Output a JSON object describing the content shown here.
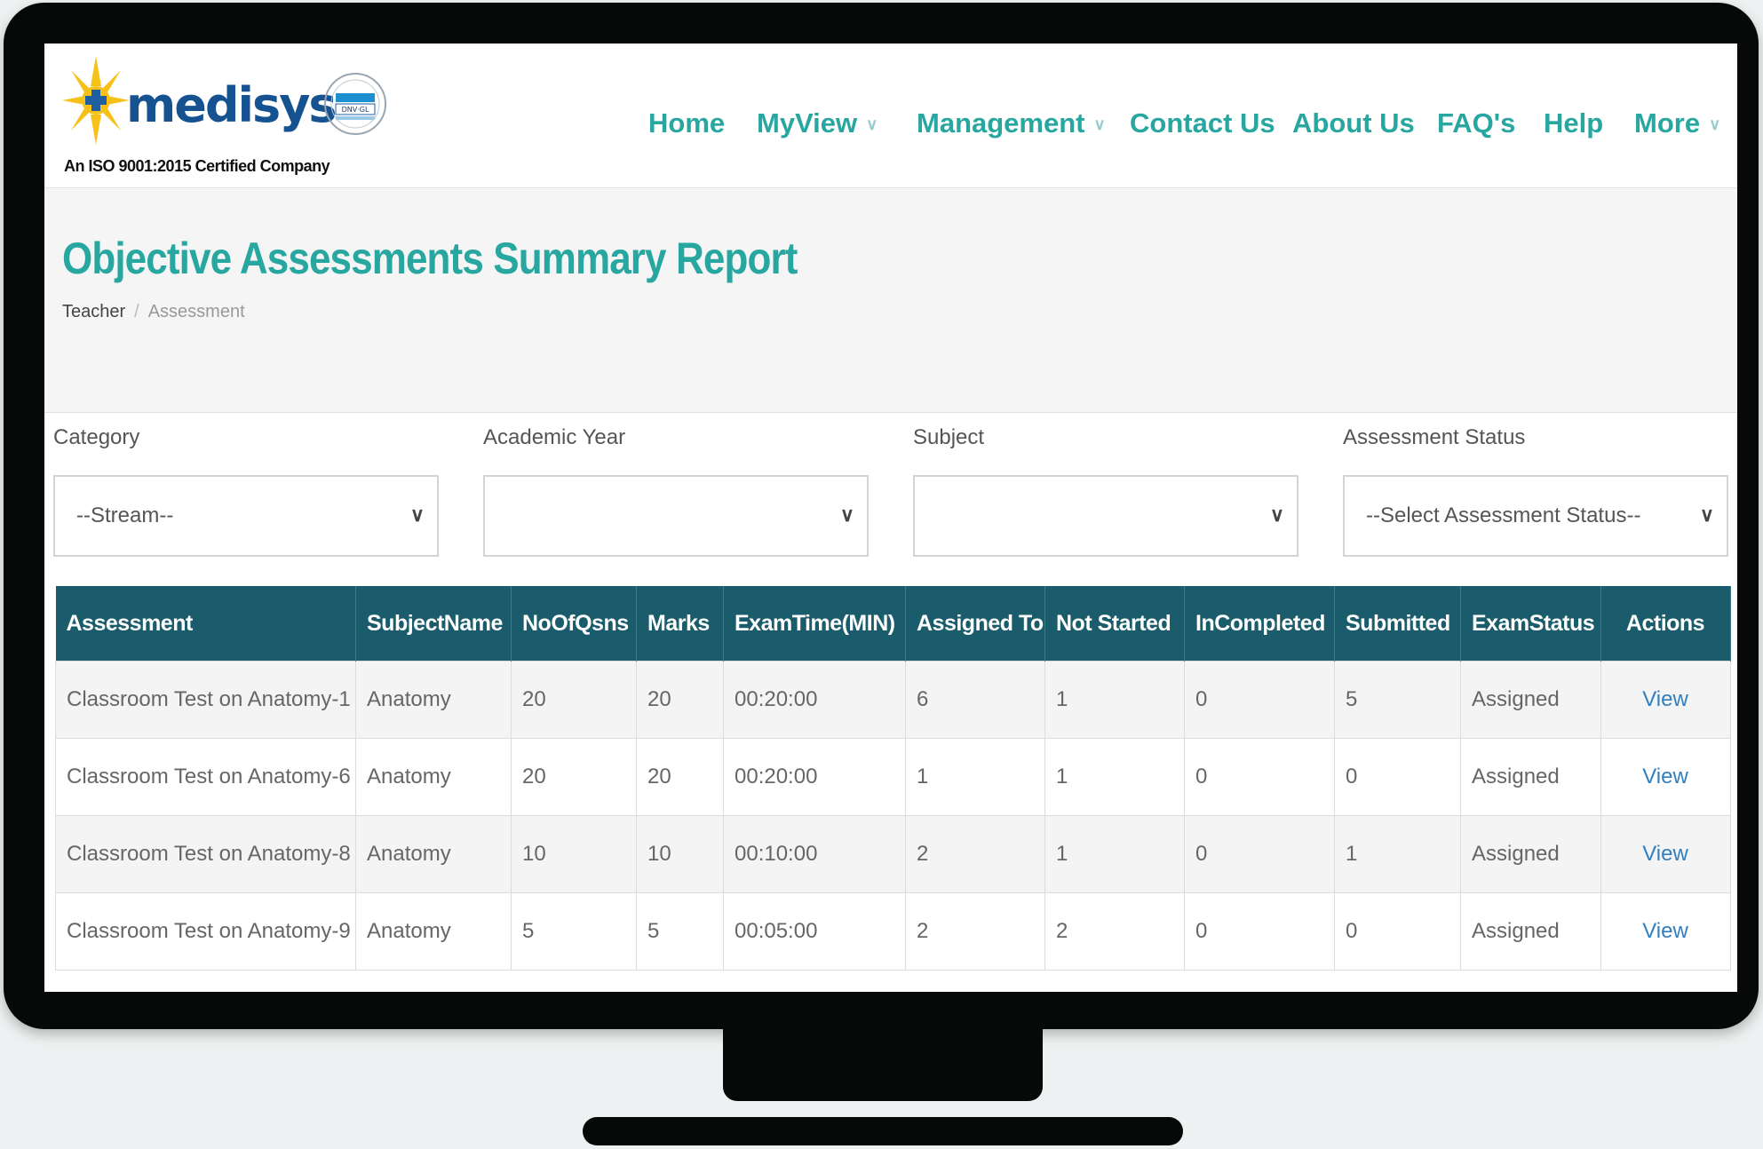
{
  "brand": {
    "name": "medisys",
    "certification": "An ISO 9001:2015 Certified Company",
    "badge_text": "DNV·GL"
  },
  "nav": [
    {
      "label": "Home",
      "dropdown": false
    },
    {
      "label": "MyView",
      "dropdown": true
    },
    {
      "label": "Management",
      "dropdown": true
    },
    {
      "label": "Contact Us",
      "dropdown": false
    },
    {
      "label": "About Us",
      "dropdown": false
    },
    {
      "label": "FAQ's",
      "dropdown": false
    },
    {
      "label": "Help",
      "dropdown": false
    },
    {
      "label": "More",
      "dropdown": true
    }
  ],
  "page": {
    "title": "Objective Assessments Summary Report",
    "breadcrumb": [
      "Teacher",
      "Assessment"
    ]
  },
  "filters": [
    {
      "label": "Category",
      "value": "--Stream--"
    },
    {
      "label": "Academic Year",
      "value": ""
    },
    {
      "label": "Subject",
      "value": ""
    },
    {
      "label": "Assessment Status",
      "value": "--Select Assessment Status--"
    }
  ],
  "table": {
    "columns": [
      "Assessment",
      "SubjectName",
      "NoOfQsns",
      "Marks",
      "ExamTime(MIN)",
      "Assigned To",
      "Not Started",
      "InCompleted",
      "Submitted",
      "ExamStatus",
      "Actions"
    ],
    "rows": [
      [
        "Classroom Test on Anatomy-1",
        "Anatomy",
        "20",
        "20",
        "00:20:00",
        "6",
        "1",
        "0",
        "5",
        "Assigned",
        "View"
      ],
      [
        "Classroom Test on Anatomy-6",
        "Anatomy",
        "20",
        "20",
        "00:20:00",
        "1",
        "1",
        "0",
        "0",
        "Assigned",
        "View"
      ],
      [
        "Classroom Test on Anatomy-8",
        "Anatomy",
        "10",
        "10",
        "00:10:00",
        "2",
        "1",
        "0",
        "1",
        "Assigned",
        "View"
      ],
      [
        "Classroom Test on Anatomy-9",
        "Anatomy",
        "5",
        "5",
        "00:05:00",
        "2",
        "2",
        "0",
        "0",
        "Assigned",
        "View"
      ]
    ]
  },
  "colors": {
    "accent": "#27a7a0",
    "table_header": "#1a5c6b",
    "link": "#2f7fc1",
    "brand_text": "#15528f"
  }
}
